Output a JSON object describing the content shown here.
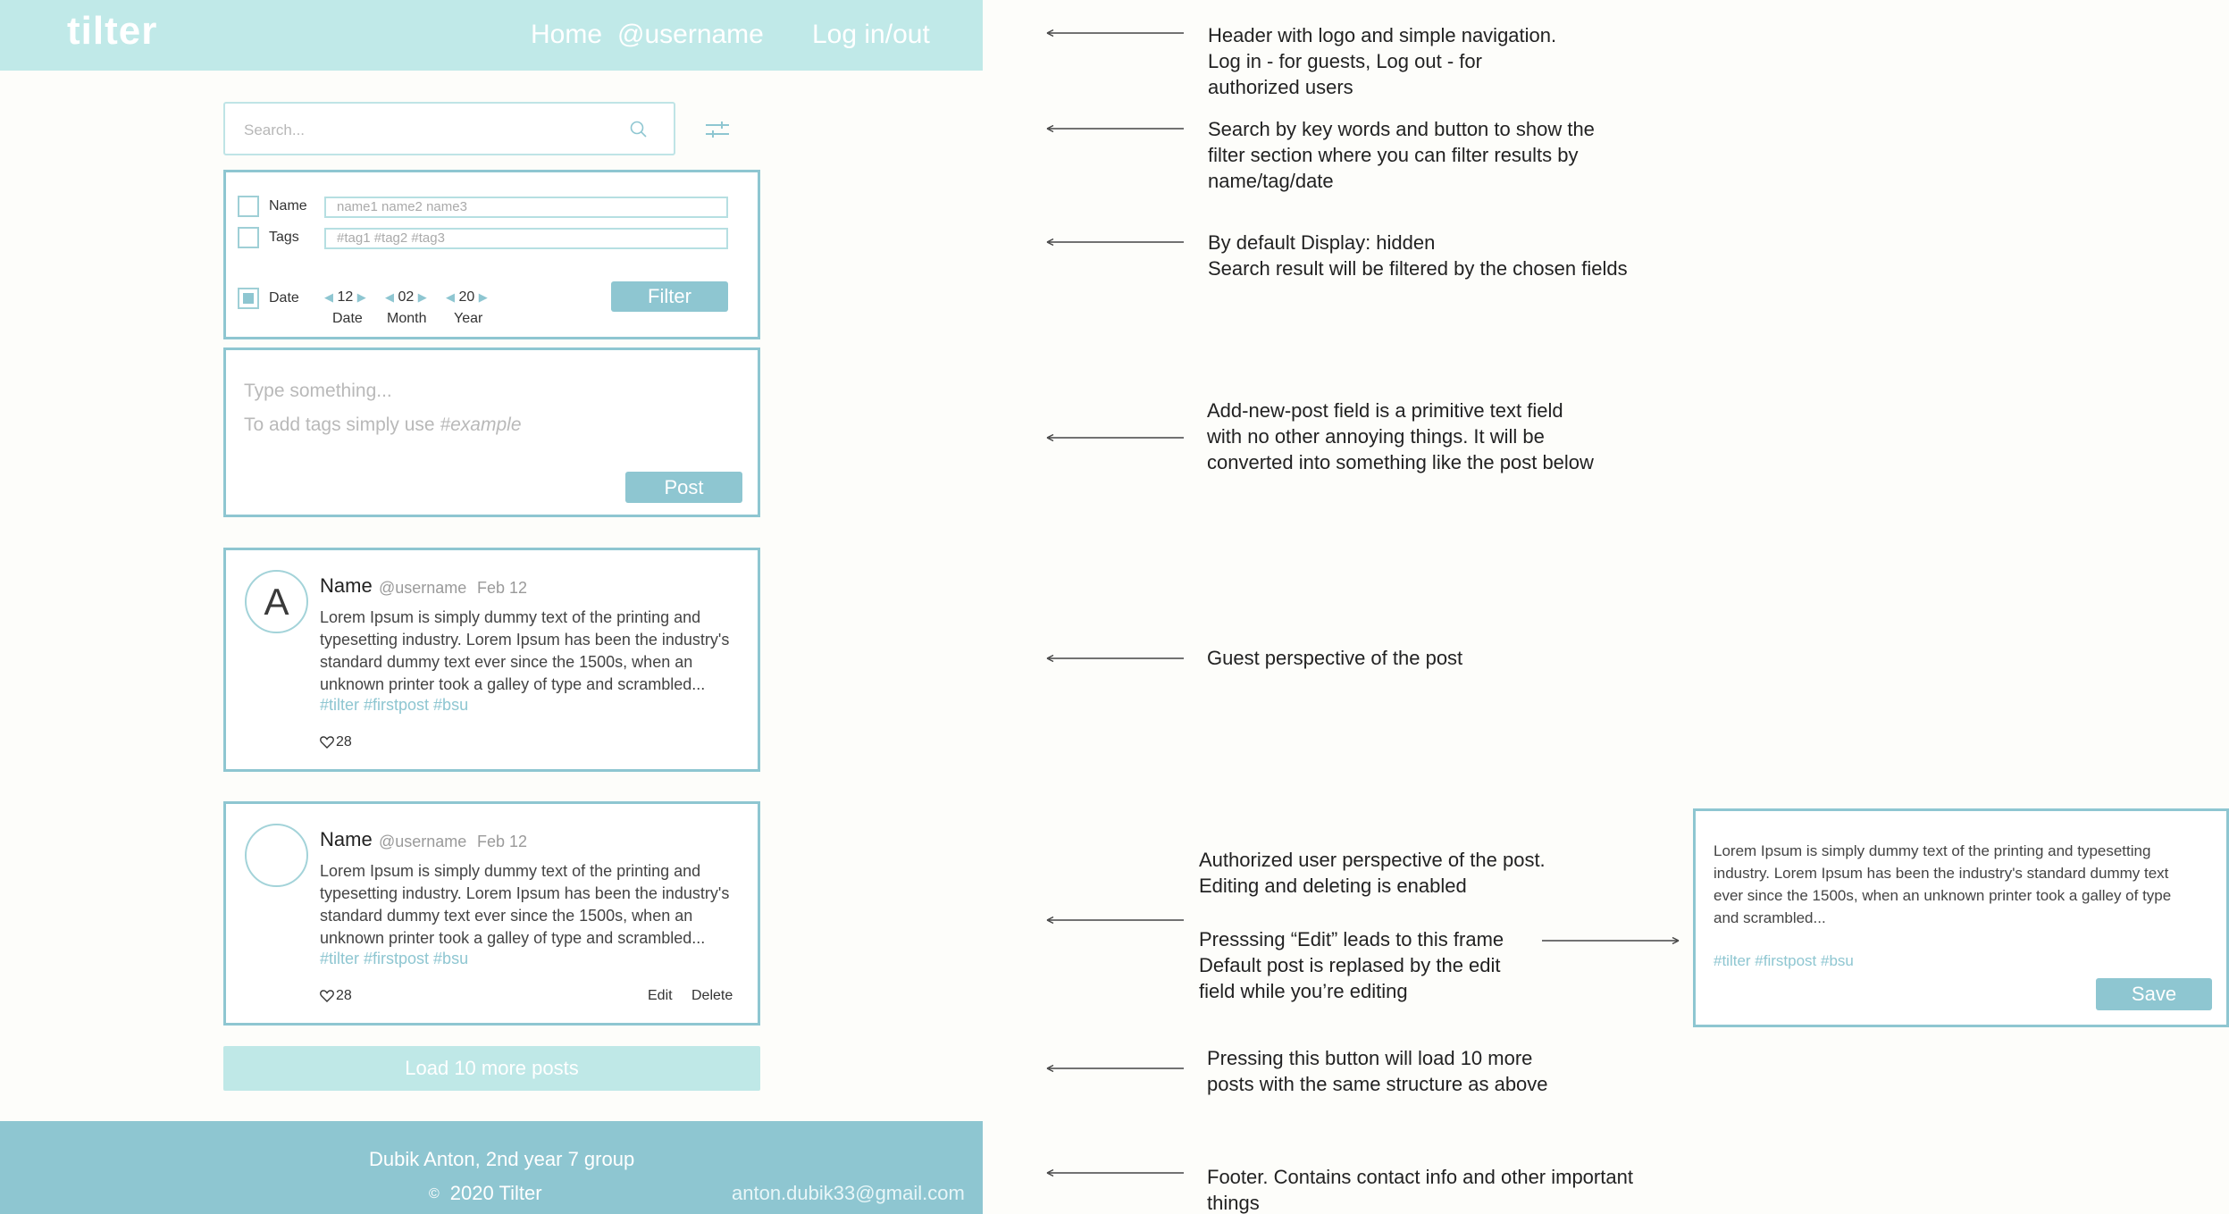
{
  "header": {
    "logo": "tilter",
    "nav": {
      "home": "Home",
      "username": "@username",
      "login": "Log in/out"
    }
  },
  "search": {
    "placeholder": "Search..."
  },
  "filter": {
    "name_label": "Name",
    "name_placeholder": "name1 name2 name3",
    "tags_label": "Tags",
    "tags_placeholder": "#tag1 #tag2 #tag3",
    "date_label": "Date",
    "date": {
      "day": "12",
      "month": "02",
      "year": "20"
    },
    "captions": {
      "day": "Date",
      "month": "Month",
      "year": "Year"
    },
    "checked": {
      "name": false,
      "tags": false,
      "date": true
    },
    "button": "Filter"
  },
  "new_post": {
    "placeholder1": "Type something...",
    "placeholder2_prefix": "To add tags simply use ",
    "placeholder2_example": "#example",
    "button": "Post"
  },
  "posts": [
    {
      "avatar": "A",
      "name": "Name",
      "username": "@username",
      "date": "Feb 12",
      "body": "Lorem Ipsum is simply dummy text of the printing and typesetting industry. Lorem Ipsum has been the industry's standard dummy text ever since the 1500s, when an unknown printer took a galley of type and scrambled...",
      "tags": "#tilter #firstpost #bsu",
      "likes": "28"
    },
    {
      "avatar": "",
      "name": "Name",
      "username": "@username",
      "date": "Feb 12",
      "body": "Lorem Ipsum is simply dummy text of the printing and typesetting industry. Lorem Ipsum has been the industry's standard dummy text ever since the 1500s, when an unknown printer took a galley of type and scrambled...",
      "tags": "#tilter #firstpost #bsu",
      "likes": "28",
      "edit": "Edit",
      "delete": "Delete"
    }
  ],
  "load_more": "Load 10 more posts",
  "footer": {
    "line1": "Dubik Anton, 2nd year 7 group",
    "copyright_symbol": "©",
    "copyright": "2020  Tilter",
    "email": "anton.dubik33@gmail.com"
  },
  "annotations": {
    "header": [
      "Header with logo and simple navigation.",
      "Log in - for guests, Log out - for",
      "authorized users"
    ],
    "search": [
      "Search by key words and button to show the",
      "filter section where you can filter results by",
      "name/tag/date"
    ],
    "filter": [
      "By default Display: hidden",
      "Search result will be filtered by the chosen fields"
    ],
    "new_post": [
      "Add-new-post field is a primitive text field",
      "with no other annoying things. It will be",
      "converted into something like the post below"
    ],
    "guest": [
      "Guest perspective of the post"
    ],
    "auth": [
      "Authorized user perspective of the post.",
      "Editing and deleting is enabled"
    ],
    "edit": [
      "Presssing “Edit” leads to this frame",
      "Default post is replased by the edit",
      "field while you’re editing"
    ],
    "load": [
      "Pressing this button will load 10 more",
      "posts with the same structure as above"
    ],
    "footer": [
      "Footer. Contains contact info and other important",
      "things"
    ]
  },
  "edit_frame": {
    "body": "Lorem Ipsum is simply dummy text of the printing and typesetting industry. Lorem Ipsum has been the industry's standard dummy text ever since the 1500s, when an unknown printer took a galley of type and scrambled...",
    "tags": "#tilter #firstpost #bsu",
    "button": "Save"
  },
  "colors": {
    "header": "#c0e9e8",
    "accent": "#8ec6d1",
    "footer": "#8ec6d1",
    "load_more": "#bfe8e7"
  }
}
